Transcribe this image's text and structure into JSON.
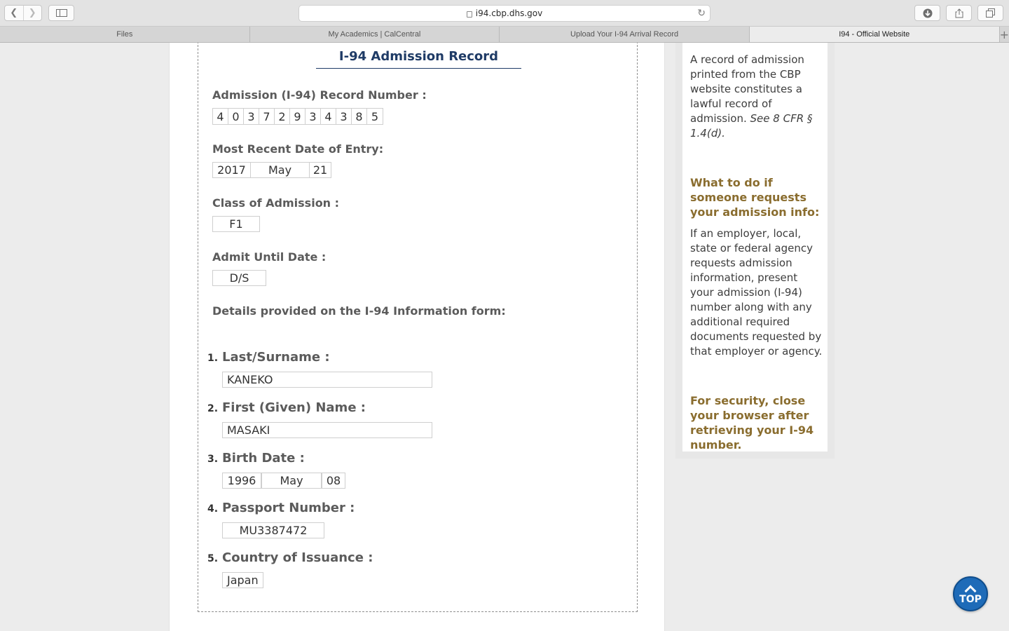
{
  "browser": {
    "url": "i94.cbp.dhs.gov",
    "tabs": [
      {
        "label": "Files"
      },
      {
        "label": "My Academics | CalCentral"
      },
      {
        "label": "Upload Your I-94 Arrival Record"
      },
      {
        "label": "I94 - Official Website"
      }
    ]
  },
  "record": {
    "title": "I-94 Admission Record",
    "record_number_label": "Admission (I-94) Record Number :",
    "record_digits": [
      "4",
      "0",
      "3",
      "7",
      "2",
      "9",
      "3",
      "4",
      "3",
      "8",
      "5"
    ],
    "entry_date_label": "Most Recent Date of Entry:",
    "entry_year": "2017",
    "entry_month": "May",
    "entry_day": "21",
    "class_label": "Class of Admission :",
    "class_value": "F1",
    "admit_until_label": "Admit Until Date :",
    "admit_until_value": "D/S",
    "details_label": "Details provided on the I-94 Information form:",
    "items": [
      {
        "num": "1.",
        "label": "Last/Surname :",
        "value": "KANEKO"
      },
      {
        "num": "2.",
        "label": "First (Given) Name :",
        "value": "MASAKI"
      },
      {
        "num": "3.",
        "label": "Birth Date :",
        "year": "1996",
        "month": "May",
        "day": "08"
      },
      {
        "num": "4.",
        "label": "Passport Number :",
        "value": "MU3387472"
      },
      {
        "num": "5.",
        "label": "Country of Issuance :",
        "value": "Japan"
      }
    ]
  },
  "sidebar": {
    "record_text": "A record of admission printed from the CBP website constitutes a lawful record of admission.",
    "record_cite": "See 8 CFR § 1.4(d).",
    "what_to_do_heading": "What to do if someone requests your admission info:",
    "what_to_do_text": "If an employer, local, state or federal agency requests admission information, present your admission (I-94) number along with any additional required documents requested by that employer or agency.",
    "security_heading": "For security, close your browser after retrieving your I-94 number."
  },
  "top_button": {
    "label": "TOP"
  }
}
